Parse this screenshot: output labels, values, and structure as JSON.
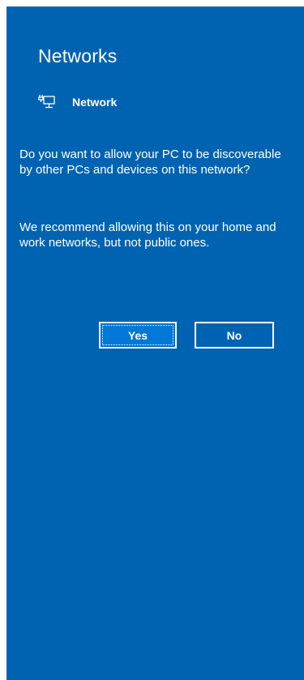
{
  "flyout": {
    "title": "Networks",
    "network": {
      "icon": "wired-network-icon",
      "name": "Network"
    },
    "prompt": "Do you want to allow your PC to be discoverable by other PCs and devices on this network?",
    "recommendation": "We recommend allowing this on your home and work networks, but not public ones.",
    "buttons": {
      "yes_label": "Yes",
      "no_label": "No"
    }
  },
  "colors": {
    "background": "#0063b1",
    "yes_button": "#0078d7",
    "text": "#ffffff"
  }
}
